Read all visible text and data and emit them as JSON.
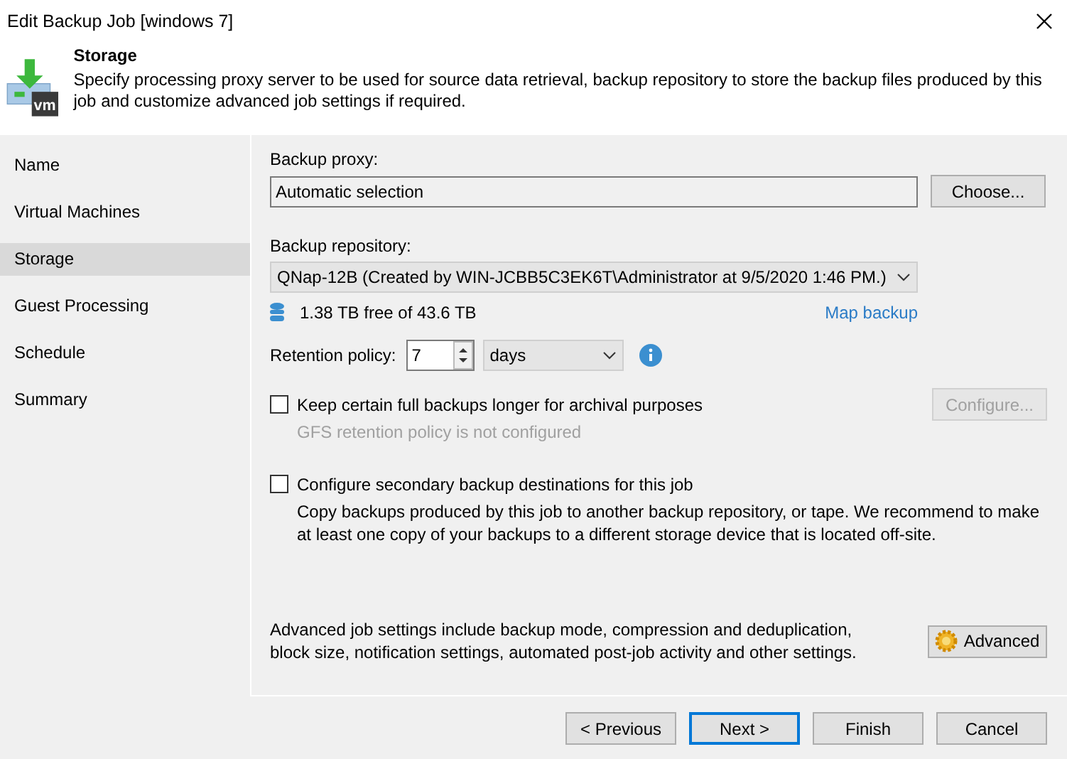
{
  "window": {
    "title": "Edit Backup Job [windows 7]"
  },
  "header": {
    "logo_text": "vm",
    "title": "Storage",
    "description": "Specify processing proxy server to be used for source data retrieval, backup repository to store the backup files produced by this job and customize advanced job settings if required."
  },
  "sidebar": {
    "items": [
      {
        "label": "Name",
        "selected": false
      },
      {
        "label": "Virtual Machines",
        "selected": false
      },
      {
        "label": "Storage",
        "selected": true
      },
      {
        "label": "Guest Processing",
        "selected": false
      },
      {
        "label": "Schedule",
        "selected": false
      },
      {
        "label": "Summary",
        "selected": false
      }
    ]
  },
  "proxy": {
    "label": "Backup proxy:",
    "value": "Automatic selection",
    "button": "Choose..."
  },
  "repository": {
    "label": "Backup repository:",
    "value": "QNap-12B (Created by WIN-JCBB5C3EK6T\\Administrator at 9/5/2020 1:46 PM.)",
    "free": "1.38 TB free of 43.6 TB",
    "link": "Map backup"
  },
  "retention": {
    "label": "Retention policy:",
    "value": "7",
    "unit": "days"
  },
  "options": [
    {
      "label": "Keep certain full backups longer for archival purposes",
      "checked": false,
      "note": "GFS retention policy is not configured",
      "note_disabled": true,
      "button": "Configure...",
      "button_disabled": true
    },
    {
      "label": "Configure secondary backup destinations for this job",
      "checked": false,
      "note": "Copy backups produced by this job to another backup repository, or tape. We recommend to make at least one copy of your backups to a different storage device that is located off-site.",
      "note_disabled": false
    }
  ],
  "advanced": {
    "text": "Advanced job settings include backup mode, compression and deduplication, block size, notification settings, automated post-job activity and other settings.",
    "button": "Advanced"
  },
  "buttons": [
    {
      "label": "< Previous",
      "default": false
    },
    {
      "label": "Next >",
      "default": true
    },
    {
      "label": "Finish",
      "default": false
    },
    {
      "label": "Cancel",
      "default": false
    }
  ]
}
